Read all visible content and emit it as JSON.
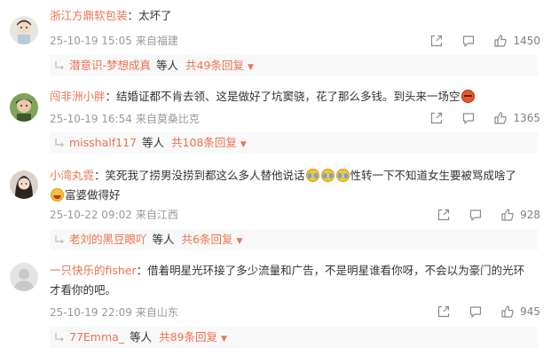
{
  "comments": [
    {
      "username": "浙江方鼎软包装",
      "text": "太坏了",
      "time": "25-10-19 15:05",
      "location": "来自福建",
      "likes": "1450",
      "reply_user": "潜意识-梦想成真",
      "reply_who": "等人",
      "reply_total": "共49条回复"
    },
    {
      "username": "闯非洲小胖",
      "text": "结婚证都不肯去领、这是做好了坑窦骁，花了那么多钱。到头来一场空",
      "emoji": "angry-face",
      "time": "25-10-19 16:54",
      "location": "来自莫桑比克",
      "likes": "1365",
      "reply_user": "misshalf117",
      "reply_who": "等人",
      "reply_total": "共108条回复"
    },
    {
      "username": "小湾丸霓",
      "text_a": "笑死我了捞男没捞到都这么多人替他说话",
      "text_b": "性转一下不知道女生要被骂成啥了",
      "text_c": "富婆做得好",
      "emoji": "crying-face",
      "time": "25-10-22 09:02",
      "location": "来自江西",
      "likes": "928",
      "reply_user": "老刘的黑豆眼吖",
      "reply_who": "等人",
      "reply_total": "共6条回复"
    },
    {
      "username": "一只快乐的fisher",
      "text_a": "借着明星光环接了多少流量和广告，不是明星谁看你呀，不会以为豪门的光环",
      "text_b": "才看你的吧。",
      "time": "25-10-19 22:09",
      "location": "来自山东",
      "likes": "945",
      "reply_user": "77Emma_",
      "reply_who": "等人",
      "reply_total": "共89条回复"
    }
  ],
  "sep": "：",
  "icons": {
    "share": "share-icon",
    "reply": "comment-icon",
    "like": "thumbs-up-icon",
    "reply_indicator": "reply-arrow-icon",
    "dropdown": "caret-down-icon"
  },
  "colors": {
    "username": "#eb7350",
    "text": "#333333",
    "meta": "#999999",
    "replybar_bg": "#f8f8f8"
  }
}
